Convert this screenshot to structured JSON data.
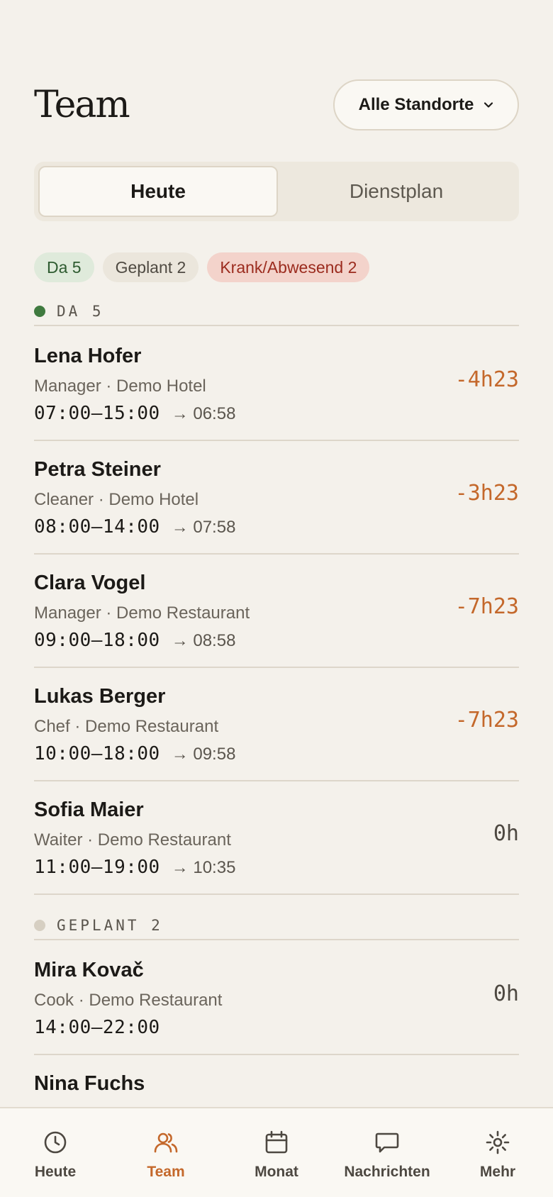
{
  "header": {
    "title": "Team",
    "location_select": "Alle Standorte"
  },
  "tabs": [
    {
      "label": "Heute",
      "active": true
    },
    {
      "label": "Dienstplan",
      "active": false
    }
  ],
  "chips": [
    {
      "label": "Da 5",
      "color": "#dfeadb"
    },
    {
      "label": "Geplant 2",
      "color": "#ebe6dc"
    },
    {
      "label": "Krank/Abwesend 2",
      "color": "#f3d3cb"
    }
  ],
  "sections": {
    "present": {
      "label": "DA 5"
    },
    "planned": {
      "label": "GEPLANT 2"
    }
  },
  "present_rows": [
    {
      "name": "Lena Hofer",
      "role": "Manager · Demo Hotel",
      "shift": "07:00–15:00",
      "clock_in": "→ 06:58",
      "delta": "-4h23"
    },
    {
      "name": "Petra Steiner",
      "role": "Cleaner · Demo Hotel",
      "shift": "08:00–14:00",
      "clock_in": "→ 07:58",
      "delta": "-3h23"
    },
    {
      "name": "Clara Vogel",
      "role": "Manager · Demo Restaurant",
      "shift": "09:00–18:00",
      "clock_in": "→ 08:58",
      "delta": "-7h23"
    },
    {
      "name": "Lukas Berger",
      "role": "Chef · Demo Restaurant",
      "shift": "10:00–18:00",
      "clock_in": "→ 09:58",
      "delta": "-7h23"
    },
    {
      "name": "Sofia Maier",
      "role": "Waiter · Demo Restaurant",
      "shift": "11:00–19:00",
      "clock_in": "→ 10:35",
      "delta": "0h"
    }
  ],
  "planned_rows": [
    {
      "name": "Mira Kovač",
      "role": "Cook · Demo Restaurant",
      "shift": "14:00–22:00",
      "clock_in": "",
      "delta": "0h"
    },
    {
      "name": "Nina Fuchs",
      "role": "",
      "shift": "",
      "clock_in": "",
      "delta": ""
    }
  ],
  "nav": [
    {
      "label": "Heute",
      "icon": "clock-icon",
      "active": false
    },
    {
      "label": "Team",
      "icon": "users-icon",
      "active": true
    },
    {
      "label": "Monat",
      "icon": "calendar-icon",
      "active": false
    },
    {
      "label": "Nachrichten",
      "icon": "message-icon",
      "active": false
    },
    {
      "label": "Mehr",
      "icon": "gear-icon",
      "active": false
    }
  ],
  "colors": {
    "accent": "#c4682b",
    "background": "#f4f1eb",
    "present_dot": "#3f7a3f",
    "planned_dot": "#d6cfc2"
  }
}
